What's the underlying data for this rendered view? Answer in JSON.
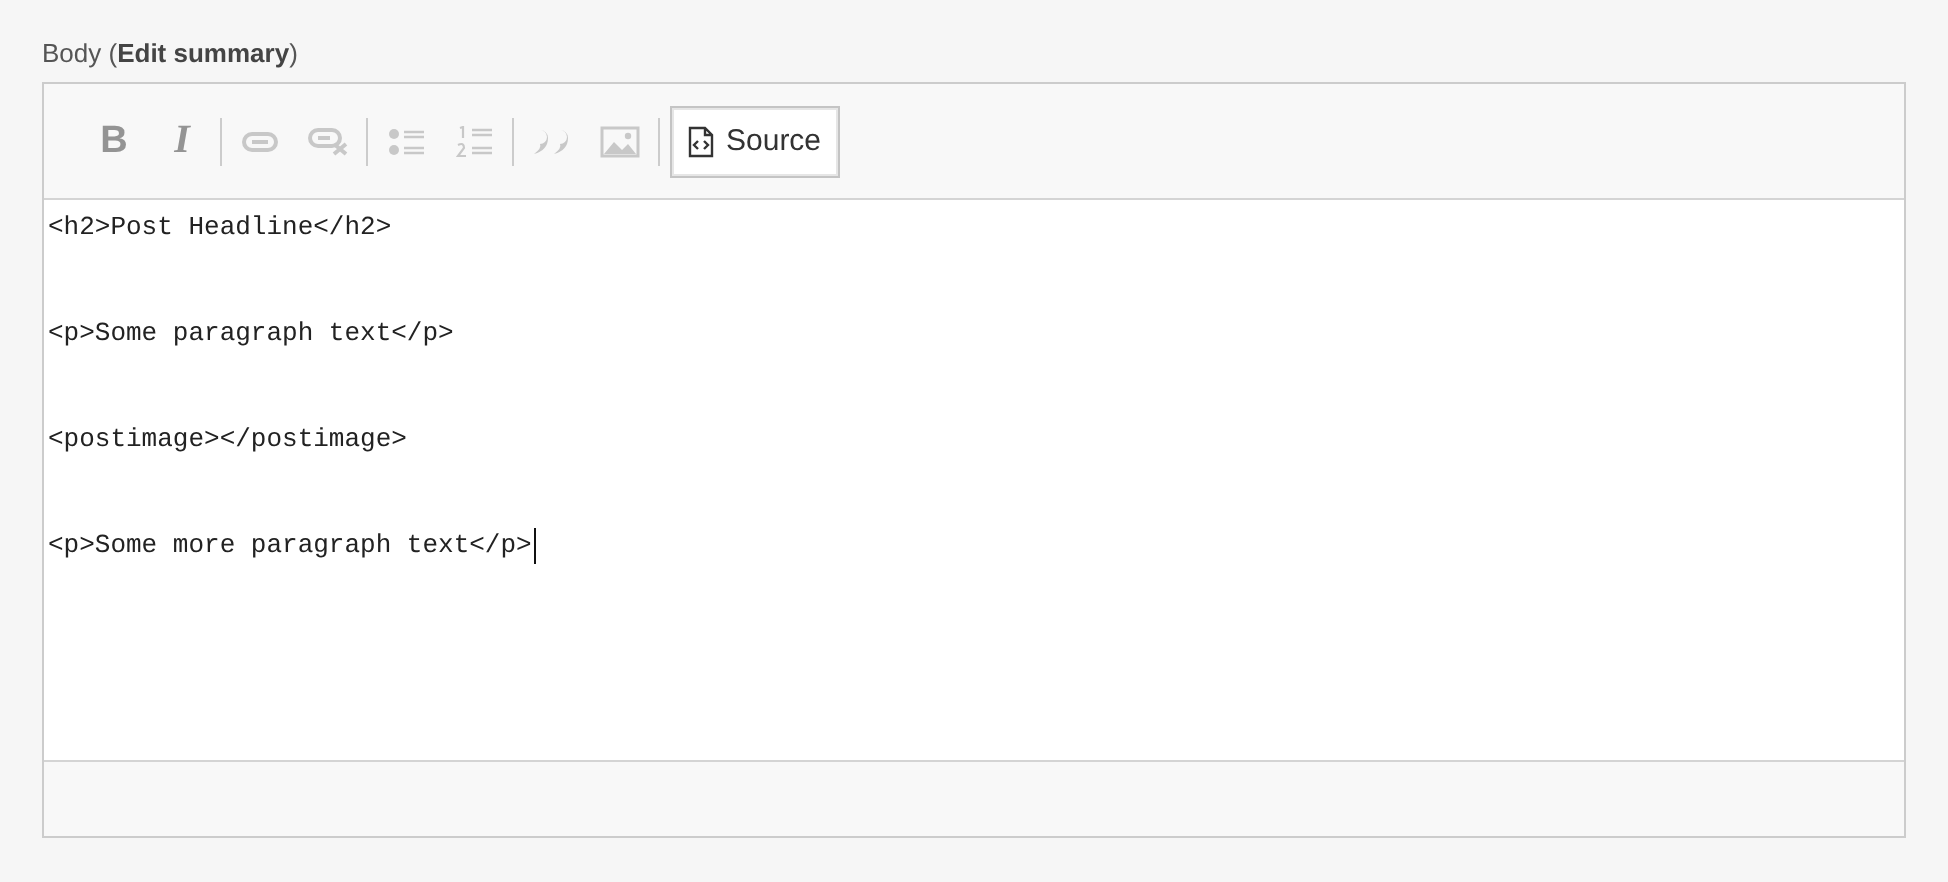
{
  "field": {
    "label": "Body (**Edit summary**)"
  },
  "toolbar": [
    {
      "kind": "bold",
      "label": "B",
      "disabled": true
    },
    {
      "kind": "italic",
      "label": "I",
      "disabled": true
    },
    {
      "kind": "separator"
    },
    {
      "kind": "link",
      "disabled": true
    },
    {
      "kind": "unlink",
      "disabled": true
    },
    {
      "kind": "separator"
    },
    {
      "kind": "bullets",
      "disabled": true
    },
    {
      "kind": "numbers",
      "disabled": true
    },
    {
      "kind": "separator"
    },
    {
      "kind": "quote",
      "disabled": true
    },
    {
      "kind": "image",
      "disabled": true
    },
    {
      "kind": "separator"
    },
    {
      "kind": "source",
      "label": "Source",
      "disabled": false,
      "selected": true
    }
  ],
  "source_lines": [
    "<h2>Post Headline</h2>",
    "<p>Some paragraph text</p>",
    "<postimage></postimage>",
    "<p>Some more paragraph text</p>"
  ],
  "cursor_visible": true
}
